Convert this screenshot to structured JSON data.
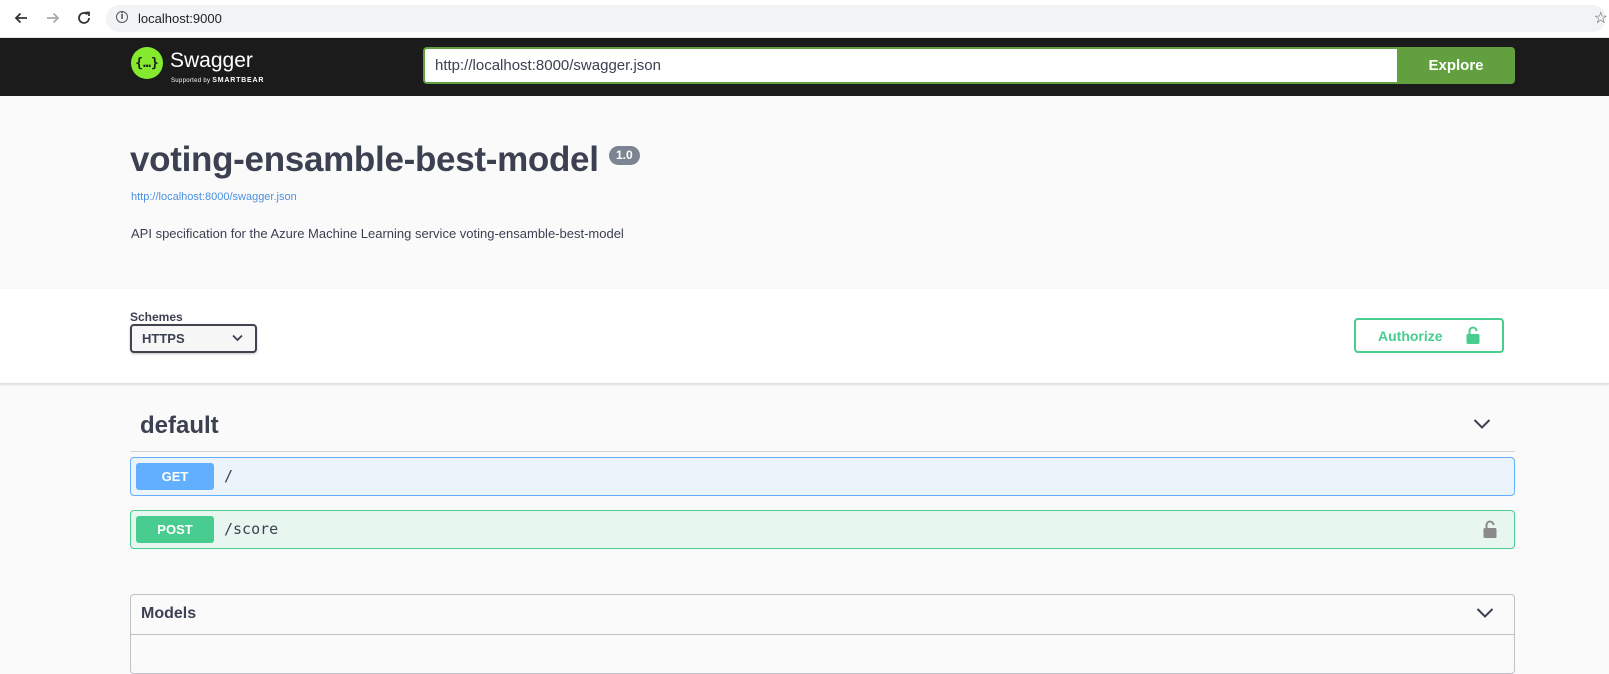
{
  "browser": {
    "url": "localhost:9000",
    "back_icon": "arrow-left-icon",
    "forward_icon": "arrow-right-icon",
    "reload_icon": "reload-icon",
    "info_icon": "info-icon",
    "bookmark_icon": "star-icon",
    "info_glyph": "i",
    "star_glyph": "☆"
  },
  "topbar": {
    "logo_icon": "swagger-logo-icon",
    "logo_glyph": "{…}",
    "logo_text": "Swagger",
    "logo_sub_prefix": "Supported by",
    "logo_sub_brand": "SMARTBEAR",
    "spec_url_value": "http://localhost:8000/swagger.json",
    "explore_label": "Explore",
    "accent_color": "#62a03f"
  },
  "info": {
    "title": "voting-ensamble-best-model",
    "version": "1.0",
    "spec_link": "http://localhost:8000/swagger.json",
    "description": "API specification for the Azure Machine Learning service voting-ensamble-best-model"
  },
  "schemes": {
    "label": "Schemes",
    "selected": "HTTPS"
  },
  "authorize": {
    "label": "Authorize",
    "icon": "unlocked-lock-icon",
    "color": "#49cc90"
  },
  "operations": {
    "tag": "default",
    "items": [
      {
        "method": "GET",
        "path": "/",
        "color": "#61affe"
      },
      {
        "method": "POST",
        "path": "/score",
        "color": "#49cc90",
        "icon": "lock-icon"
      }
    ]
  },
  "models": {
    "title": "Models"
  }
}
